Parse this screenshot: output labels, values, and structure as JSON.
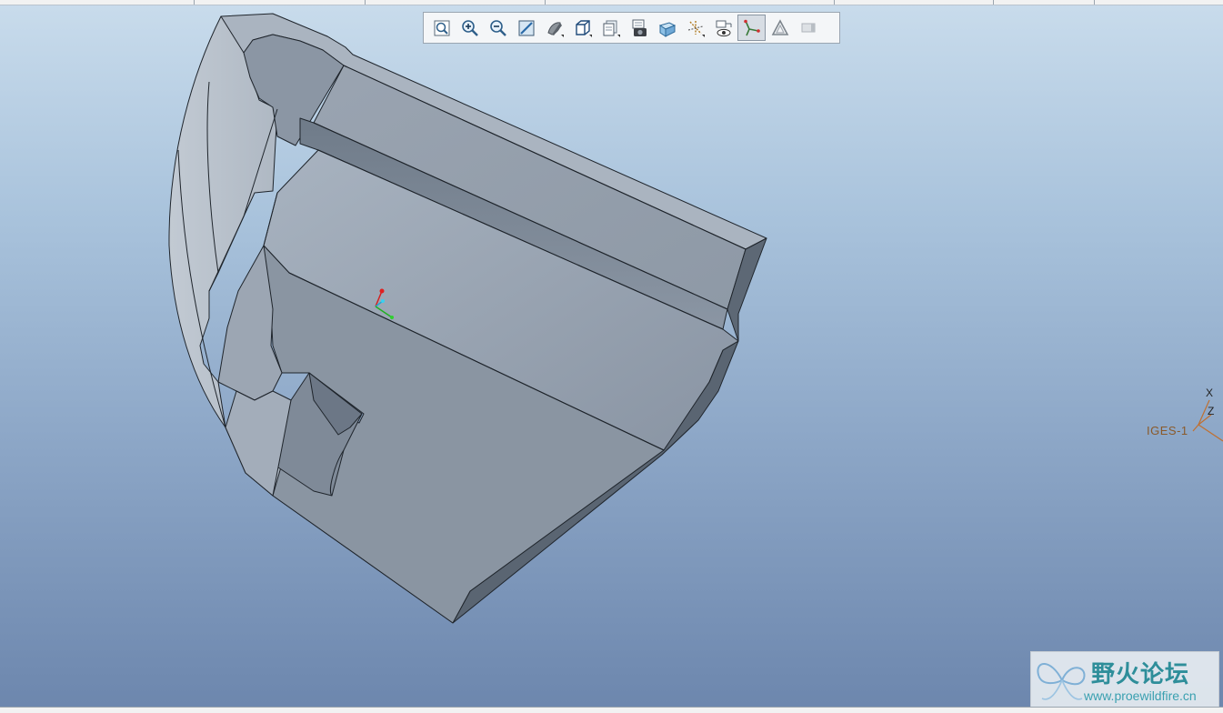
{
  "toolbar": {
    "buttons": [
      {
        "name": "refit",
        "icon": "zoom-fit-icon"
      },
      {
        "name": "zoom-in",
        "icon": "zoom-in-icon"
      },
      {
        "name": "zoom-out",
        "icon": "zoom-out-icon"
      },
      {
        "name": "repaint",
        "icon": "repaint-icon"
      },
      {
        "name": "display-style",
        "icon": "shaded-sphere-icon"
      },
      {
        "name": "saved-views",
        "icon": "cube-views-icon"
      },
      {
        "name": "layers",
        "icon": "layers-icon"
      },
      {
        "name": "view-manager",
        "icon": "camera-view-manager-icon"
      },
      {
        "name": "perspective",
        "icon": "perspective-cube-icon"
      },
      {
        "name": "datum-display",
        "icon": "datum-display-icon"
      },
      {
        "name": "annotation-display",
        "icon": "annotation-eye-icon"
      },
      {
        "name": "csys-display",
        "icon": "coordinate-system-icon",
        "active": true
      },
      {
        "name": "spin-center",
        "icon": "spin-center-icon"
      },
      {
        "name": "shade-off",
        "icon": "shade-off-icon",
        "disabled": true
      }
    ]
  },
  "model": {
    "csys_name": "IGES-1",
    "axis_labels": {
      "x": "X",
      "z": "Z"
    }
  },
  "watermark": {
    "title": "野火论坛",
    "url": "www.proewildfire.cn"
  },
  "colors": {
    "background_top": "#c9dcec",
    "background_bottom": "#6c86ad",
    "model_face": "#95a0ad",
    "model_edge": "#1f252c",
    "csys_label": "#8a5a2a",
    "watermark_text": "#2e8e9a"
  }
}
